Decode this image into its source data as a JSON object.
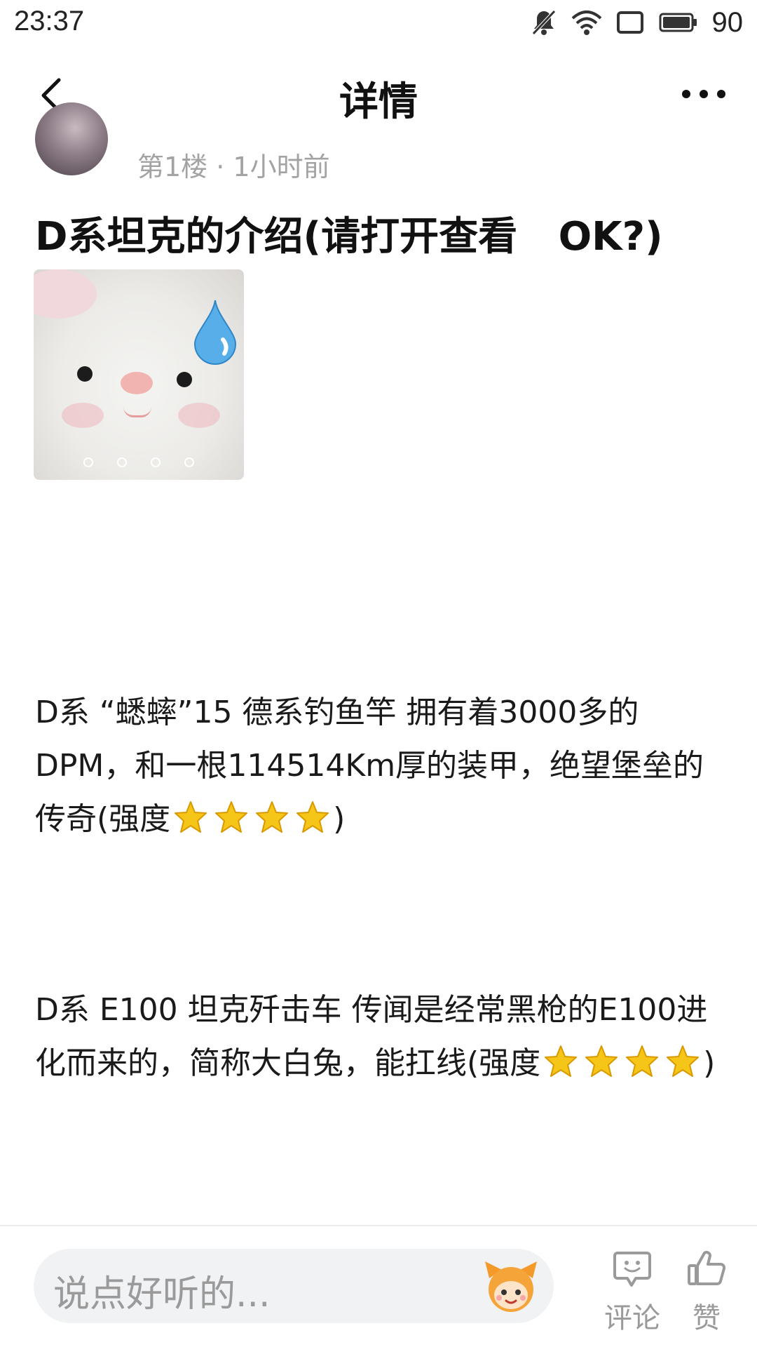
{
  "status_bar": {
    "time": "23:37",
    "battery": "90"
  },
  "nav": {
    "title": "详情"
  },
  "post": {
    "meta": "第1楼 · 1小时前",
    "title": "D系坦克的介绍(请打开查看   OK?)",
    "image_page_count": 4,
    "paragraphs": [
      {
        "text": "D系 “蟋蟀”15 德系钓鱼竿  拥有着3000多的DPM，和一根114514Km厚的装甲，绝望堡垒的传奇(强度",
        "rating": 4,
        "closing": ")"
      },
      {
        "text": "D系 E100 坦克歼击车  传闻是经常黑枪的E100进化而来的，简称大白兔，能扛线(强度",
        "rating": 4,
        "closing": ")"
      }
    ]
  },
  "bottom_bar": {
    "comment_placeholder": "说点好听的...",
    "comment_label": "评论",
    "like_label": "赞"
  },
  "colors": {
    "accent_star": "#f5c518",
    "meta_gray": "#a3a3a3"
  }
}
